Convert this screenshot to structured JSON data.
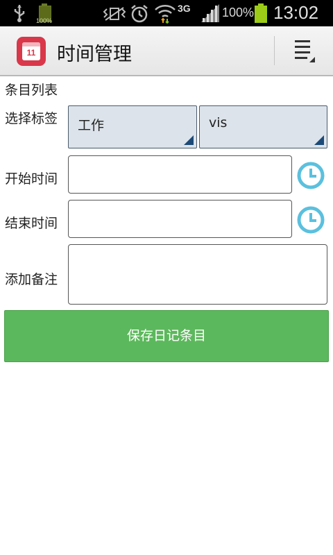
{
  "status_bar": {
    "small_battery_text": "100%",
    "network_type": "3G",
    "battery_percent": "100%",
    "time": "13:02",
    "icons": [
      "usb-icon",
      "battery-small-icon",
      "vibrate-silent-icon",
      "alarm-icon",
      "wifi-icon",
      "signal-icon",
      "battery-icon"
    ]
  },
  "action_bar": {
    "title": "时间管理",
    "app_icon_number": "11",
    "menu_icon": "overflow-menu-icon"
  },
  "form": {
    "section_title": "条目列表",
    "tag_label": "选择标签",
    "tag_primary": "工作",
    "tag_secondary": "vis",
    "start_label": "开始时间",
    "start_value": "",
    "end_label": "结束时间",
    "end_value": "",
    "note_label": "添加备注",
    "note_value": "",
    "clock_icon": "clock-icon",
    "save_button": "保存日记条目"
  },
  "colors": {
    "accent_green": "#5cb85c",
    "spinner_bg": "#dce3ea",
    "clock_blue": "#5bc0de",
    "app_icon_red": "#d9374a",
    "battery_green": "#9ccc18"
  }
}
